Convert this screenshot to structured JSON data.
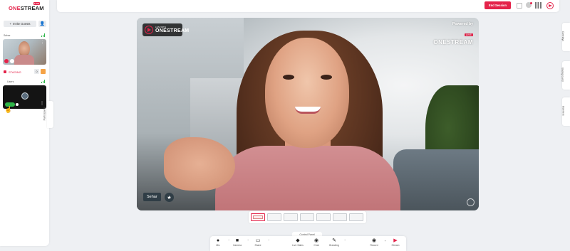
{
  "sidebar": {
    "logo": {
      "one": "ONE",
      "stream": "STREAM",
      "badge": "LIVE"
    },
    "invite_label": "Invite Guests",
    "participant_name": "Sehar",
    "staging_label": "STAGING",
    "staging_count": "0",
    "users_label": "Users"
  },
  "participants_tab": "Participants",
  "topbar": {
    "end_session": "End Session"
  },
  "right_tabs": [
    "Overlays",
    "Background",
    "Banners"
  ],
  "stage": {
    "live_logo_small": "LIVE WITH",
    "live_logo_big": "ONESTREAM",
    "powered_by": "Powered by",
    "live_chip": "LIVE",
    "brand": "ONESTREAM",
    "name_chip": "Sehar"
  },
  "control_panel_label": "Control Panel",
  "controls": [
    {
      "icon": "mic-icon",
      "glyph": "🎤",
      "label": "Mic"
    },
    {
      "icon": "camera-icon",
      "glyph": "■",
      "label": "Camera"
    },
    {
      "icon": "share-icon",
      "glyph": "▭",
      "label": "Share"
    },
    {
      "icon": "live-sales-icon",
      "glyph": "◆",
      "label": "Live Sales"
    },
    {
      "icon": "chat-icon",
      "glyph": "◉",
      "label": "Chat"
    },
    {
      "icon": "branding-icon",
      "glyph": "✎",
      "label": "Branding"
    },
    {
      "icon": "record-icon",
      "glyph": "◉",
      "label": "Record"
    },
    {
      "icon": "stream-icon",
      "glyph": "▶",
      "label": "Stream"
    }
  ],
  "colors": {
    "brand_red": "#e4234a",
    "signal_green": "#2fb64a"
  }
}
